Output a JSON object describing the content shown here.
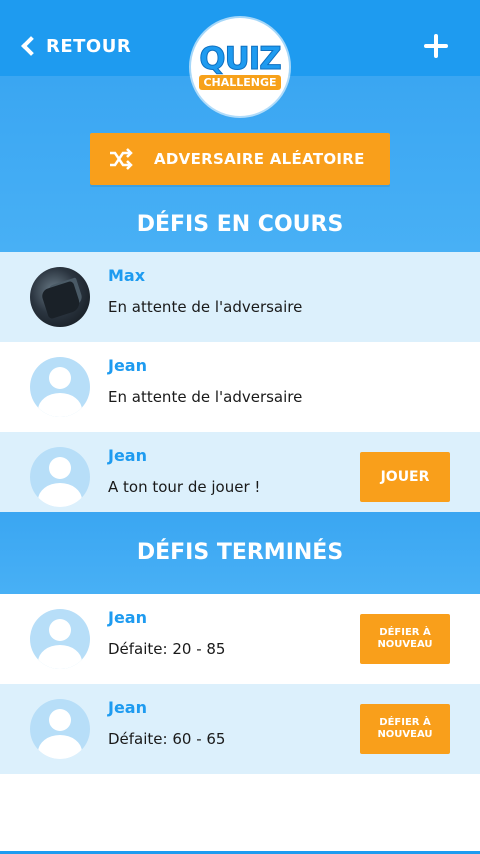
{
  "header": {
    "back_label": "RETOUR",
    "logo_top": "QUIZ",
    "logo_bottom": "CHALLENGE"
  },
  "random_button": {
    "label": "ADVERSAIRE ALÉATOIRE",
    "icon": "shuffle-icon"
  },
  "in_progress": {
    "title": "DÉFIS EN COURS",
    "items": [
      {
        "name": "Max",
        "status": "En attente de l'adversaire",
        "avatar": "photo"
      },
      {
        "name": "Jean",
        "status": "En attente de l'adversaire",
        "avatar": "default-user"
      },
      {
        "name": "Jean",
        "status": "A ton tour de jouer !",
        "avatar": "default-user",
        "action": "JOUER"
      }
    ]
  },
  "finished": {
    "title": "DÉFIS TERMINÉS",
    "items": [
      {
        "name": "Jean",
        "status": "Défaite: 20 - 85",
        "avatar": "default-user",
        "action_line1": "DÉFIER À",
        "action_line2": "NOUVEAU"
      },
      {
        "name": "Jean",
        "status": "Défaite: 60 - 65",
        "avatar": "default-user",
        "action_line1": "DÉFIER À",
        "action_line2": "NOUVEAU"
      }
    ]
  },
  "colors": {
    "primary": "#1e9bf0",
    "accent": "#f99f1b",
    "row_light": "#dcf0fc"
  }
}
